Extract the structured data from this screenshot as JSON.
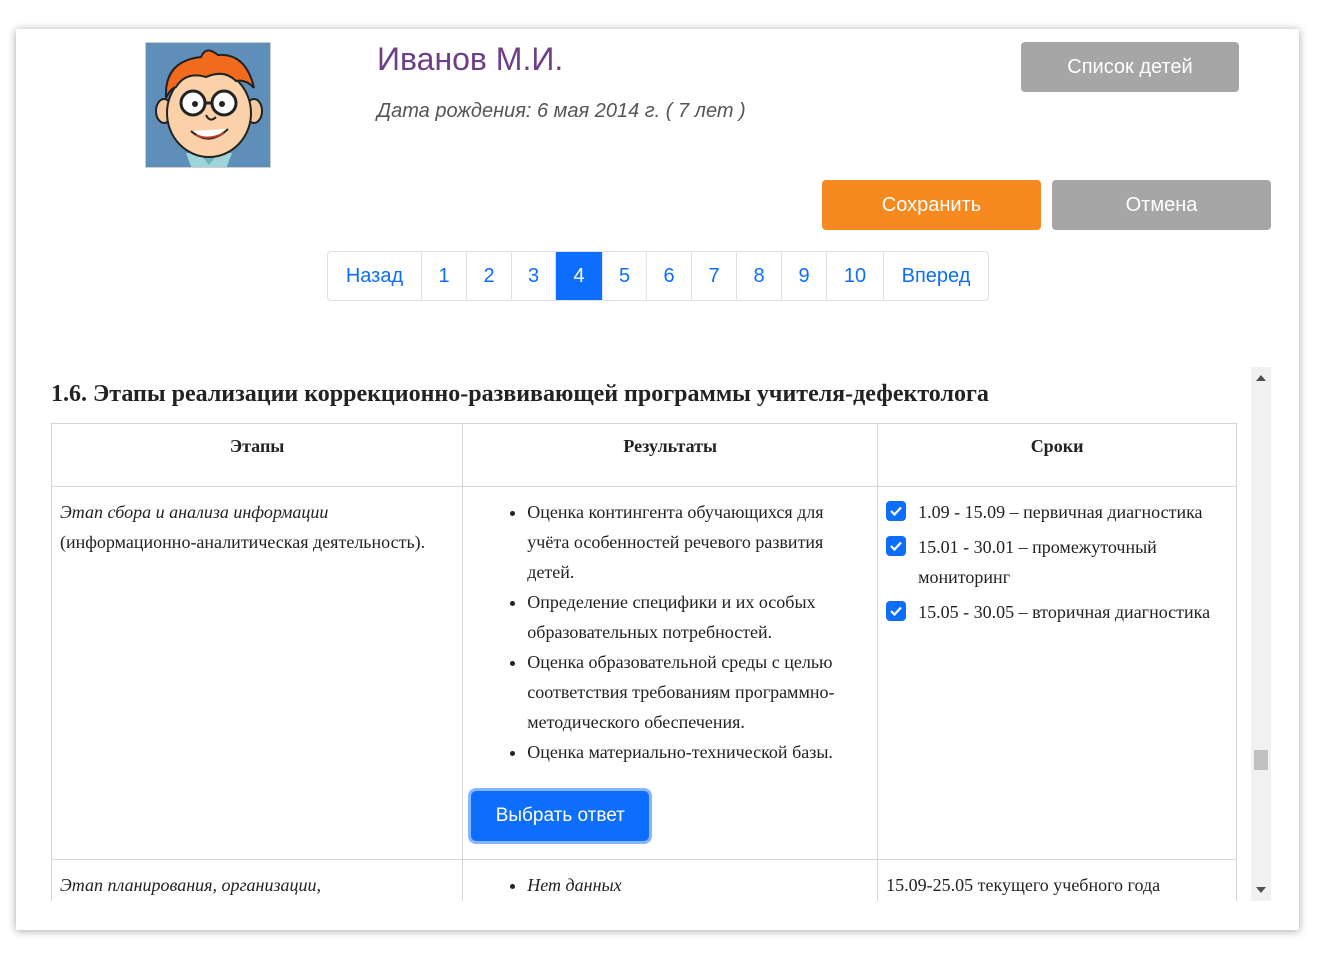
{
  "header": {
    "name": "Иванов М.И.",
    "dob": "Дата рождения: 6 мая 2014 г. ( 7 лет )",
    "list_button": "Список детей",
    "save_button": "Сохранить",
    "cancel_button": "Отмена"
  },
  "pagination": {
    "prev": "Назад",
    "next": "Вперед",
    "pages": [
      "1",
      "2",
      "3",
      "4",
      "5",
      "6",
      "7",
      "8",
      "9",
      "10"
    ],
    "active": "4"
  },
  "section": {
    "title": "1.6. Этапы реализации коррекционно-развивающей программы учителя-дефектолога",
    "headers": [
      "Этапы",
      "Результаты",
      "Сроки"
    ],
    "row1": {
      "stage_italic": "Этап сбора и анализа информации",
      "stage_rest": " (информационно-аналитическая деятельность).",
      "results": [
        "Оценка контингента обучающихся для учёта особенностей речевого развития детей.",
        "Определение специфики и их особых образовательных потребностей.",
        "Оценка образовательной среды с целью соответствия требованиям программно-методического обеспечения.",
        "Оценка материально-технической базы."
      ],
      "choose_button": "Выбрать ответ",
      "terms": [
        "1.09 - 15.09 – первичная диагностика",
        "15.01 - 30.01 – промежуточный мониторинг",
        "15.05 - 30.05 – вторичная диагностика"
      ]
    },
    "row2": {
      "stage_italic": "Этап планирования, организации,",
      "result": "Нет данных",
      "term": "15.09-25.05 текущего учебного года"
    }
  },
  "colors": {
    "accent": "#0d6efd",
    "save": "#f68a20",
    "grey_button": "#a6a6a6",
    "name": "#6e3f86"
  }
}
